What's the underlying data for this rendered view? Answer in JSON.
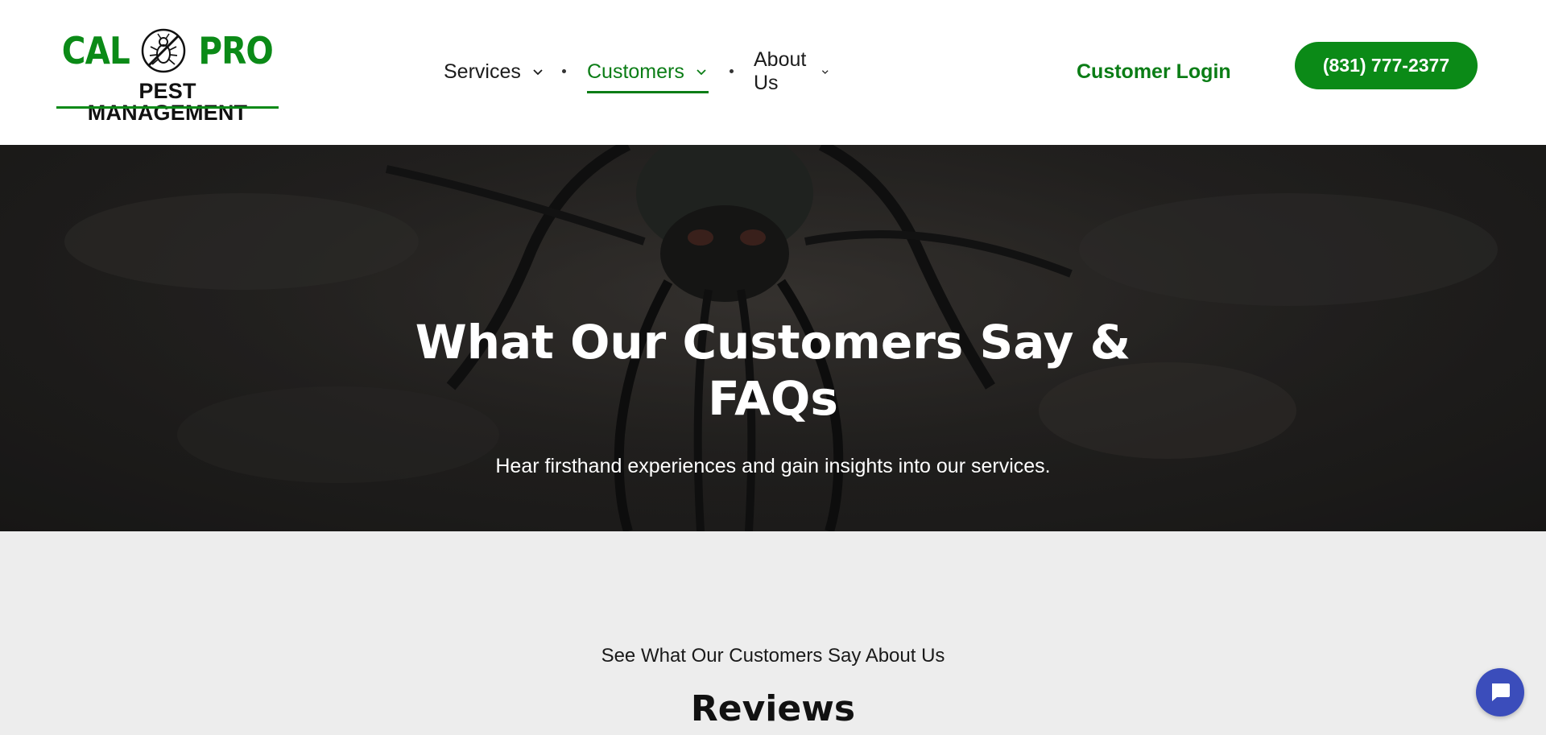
{
  "brand": {
    "logo_word_left": "CAL",
    "logo_word_right": "PRO",
    "logo_subtitle": "PEST MANAGEMENT",
    "accent_color": "#0b8a17",
    "logo_icon": "bug-crossed-icon"
  },
  "nav": {
    "items": [
      {
        "label": "Services",
        "active": false
      },
      {
        "label": "Customers",
        "active": true
      },
      {
        "label": "About Us",
        "active": false
      }
    ],
    "login_label": "Customer Login",
    "phone_label": "(831) 777-2377"
  },
  "hero": {
    "title": "What Our Customers Say & FAQs",
    "subtitle": "Hear firsthand experiences and gain insights into our services."
  },
  "reviews": {
    "kicker": "See What Our Customers Say About Us",
    "title": "Reviews"
  },
  "chat": {
    "icon": "chat-bubble-icon",
    "color": "#3b4dbb"
  }
}
